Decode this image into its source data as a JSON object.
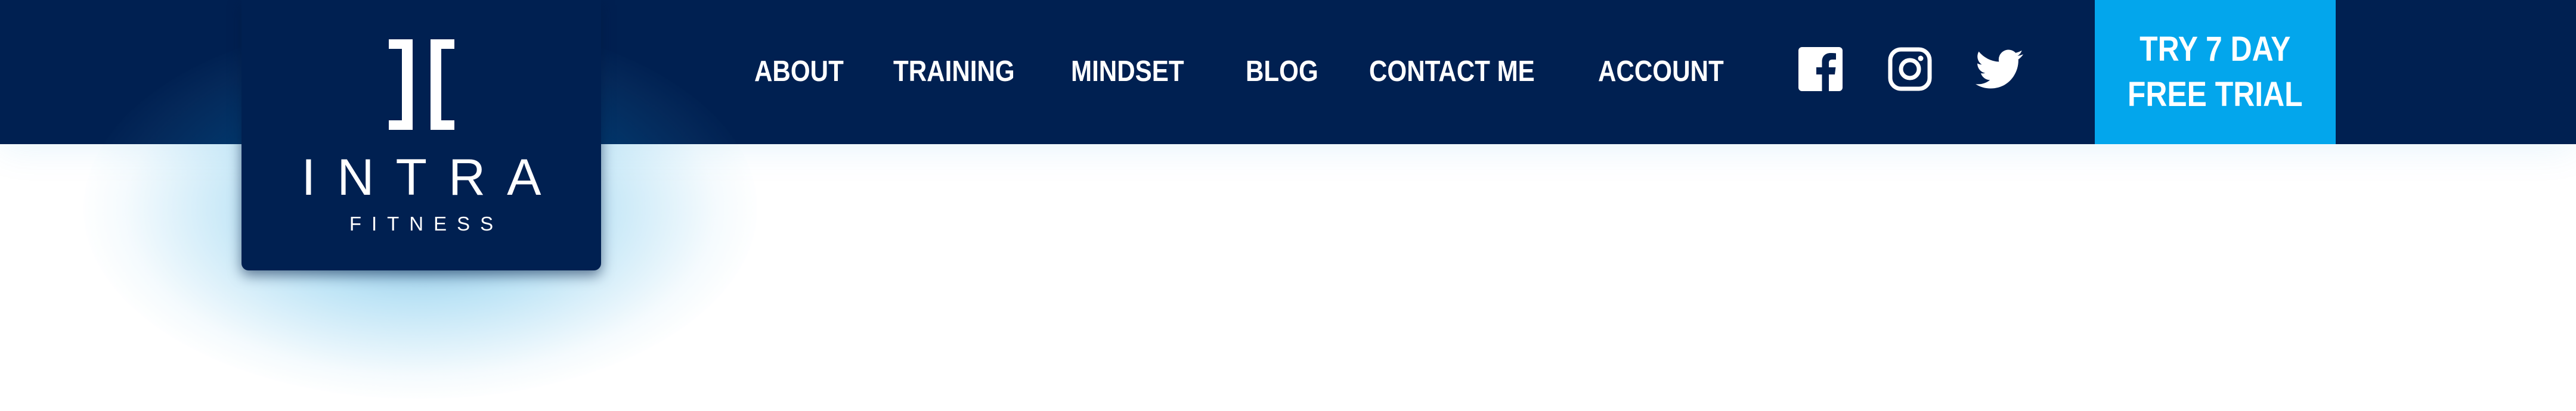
{
  "brand": {
    "name": "INTRA",
    "subtitle": "FITNESS",
    "icon": "intra-logo-icon"
  },
  "nav": {
    "items": [
      {
        "label": "ABOUT"
      },
      {
        "label": "TRAINING"
      },
      {
        "label": "MINDSET"
      },
      {
        "label": "BLOG"
      },
      {
        "label": "CONTACT ME"
      },
      {
        "label": "ACCOUNT"
      }
    ]
  },
  "social": {
    "icons": [
      "facebook-icon",
      "instagram-icon",
      "twitter-icon"
    ]
  },
  "cta": {
    "label": "TRY 7 DAY\nFREE TRIAL"
  },
  "colors": {
    "navy": "#002051",
    "accent": "#03a6ec",
    "text": "#ffffff"
  }
}
